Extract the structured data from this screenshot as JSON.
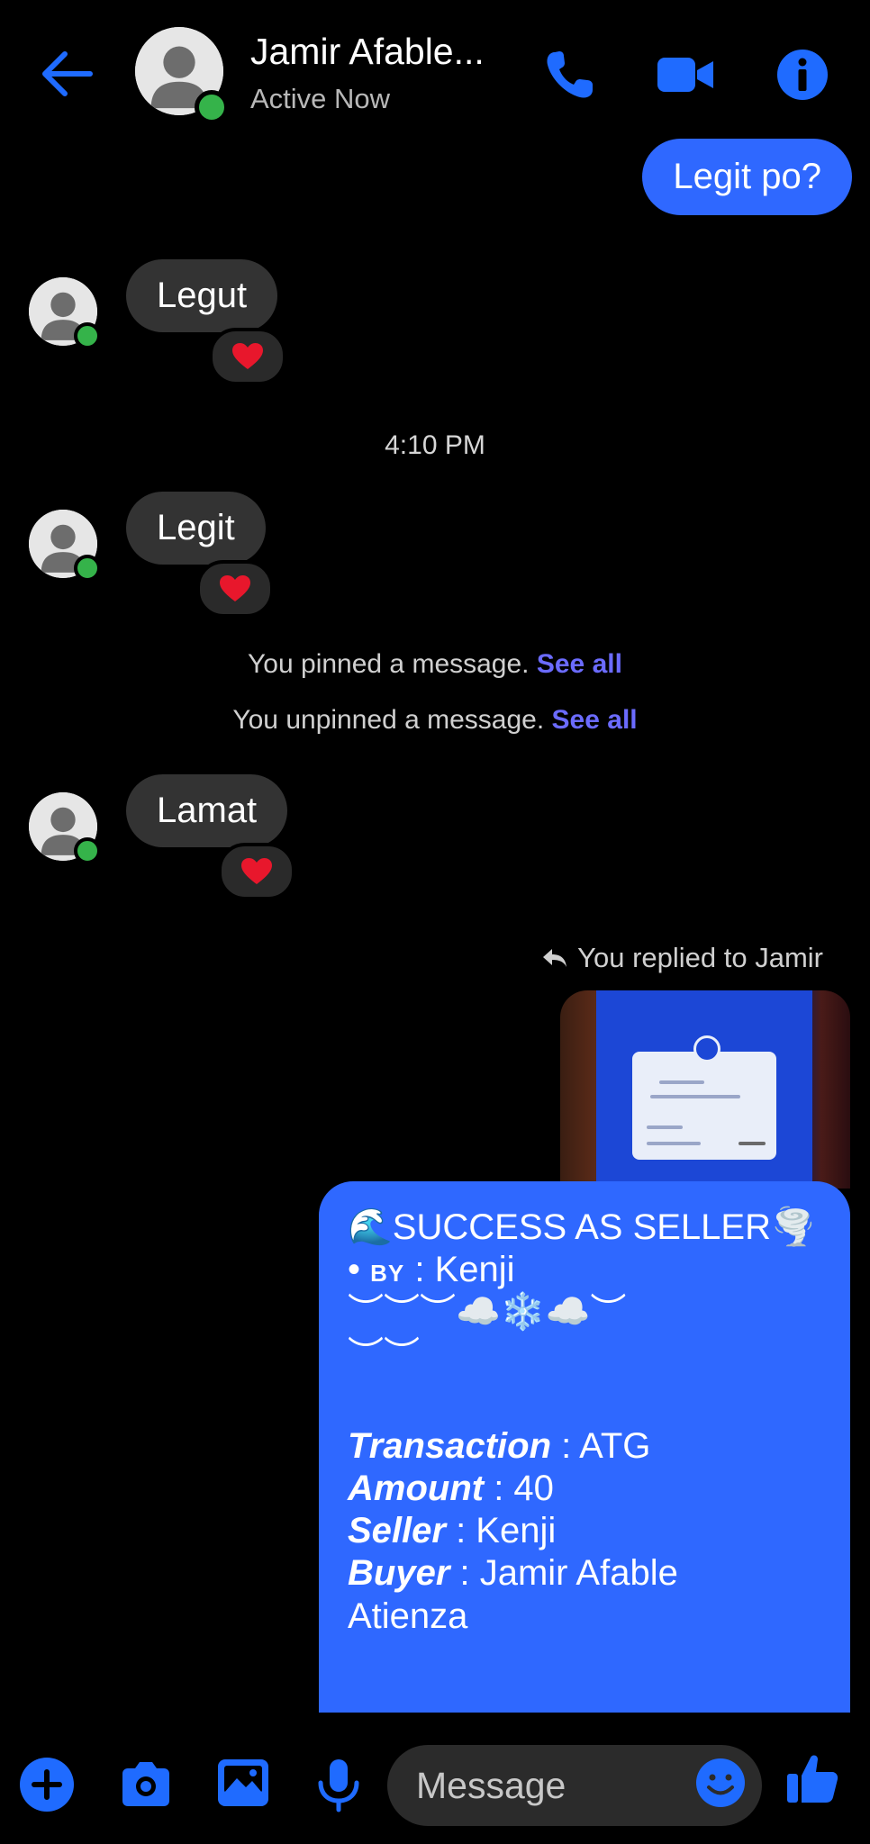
{
  "header": {
    "contact_name": "Jamir Afable...",
    "status": "Active Now"
  },
  "messages": {
    "outgoing_1": "Legit po?",
    "incoming_1": "Legut",
    "timestamp": "4:10 PM",
    "incoming_2": "Legit",
    "pinned_text": "You pinned a message.",
    "pinned_link": "See all",
    "unpinned_text": "You unpinned a message.",
    "unpinned_link": "See all",
    "incoming_3": "Lamat",
    "reply_note": "You replied to Jamir",
    "reaction": "heart"
  },
  "receipt": {
    "title": "🌊SUCCESS AS SELLER🌪️",
    "by_prefix": "• ",
    "by_label": "BY",
    "by_value": " : Kenji",
    "deco_1": "︶︶︶☁️❄️☁️︶",
    "deco_2": "︶︶",
    "transaction_label": "Transaction",
    "transaction_value": " : ATG",
    "amount_label": "Amount",
    "amount_value": " : 40",
    "seller_label": "Seller",
    "seller_value": " : Kenji",
    "buyer_label": "Buyer",
    "buyer_value": " : Jamir Afable",
    "buyer_value_2": "Atienza"
  },
  "composer": {
    "placeholder": "Message"
  },
  "colors": {
    "accent": "#1f6bff",
    "outgoing_bubble": "#2f68ff",
    "incoming_bubble": "#333333",
    "online": "#35b34a",
    "link": "#6b6bff"
  },
  "icons": [
    "back-arrow-icon",
    "phone-icon",
    "video-camera-icon",
    "info-icon",
    "heart-icon",
    "reply-arrow-icon",
    "plus-icon",
    "camera-icon",
    "gallery-icon",
    "microphone-icon",
    "emoji-icon",
    "thumbs-up-icon"
  ]
}
